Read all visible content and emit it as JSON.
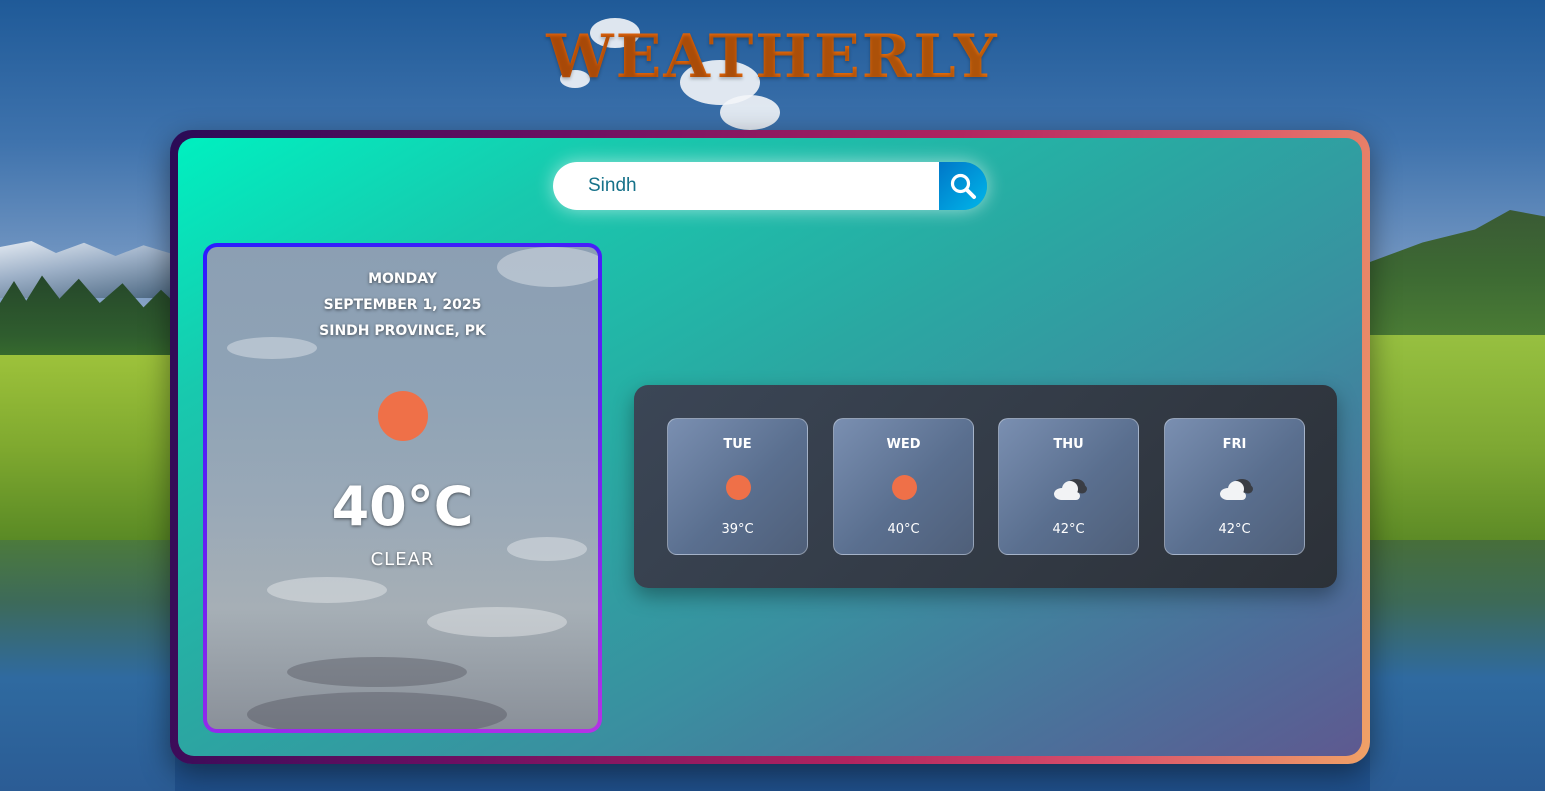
{
  "app": {
    "title": "WEATHERLY"
  },
  "search": {
    "value": "Sindh",
    "placeholder": "",
    "button_icon": "search-icon"
  },
  "today": {
    "day": "MONDAY",
    "date": "SEPTEMBER 1, 2025",
    "location": "SINDH PROVINCE, PK",
    "icon": "sun-icon",
    "temperature": "40°C",
    "condition": "CLEAR"
  },
  "forecast": [
    {
      "day": "TUE",
      "icon": "sun-icon",
      "temp": "39°C"
    },
    {
      "day": "WED",
      "icon": "sun-icon",
      "temp": "40°C"
    },
    {
      "day": "THU",
      "icon": "cloudy-icon",
      "temp": "42°C"
    },
    {
      "day": "FRI",
      "icon": "cloudy-icon",
      "temp": "42°C"
    }
  ],
  "colors": {
    "title": "#e8650a",
    "sun": "#ef7048",
    "search_button": "#0089d2"
  }
}
